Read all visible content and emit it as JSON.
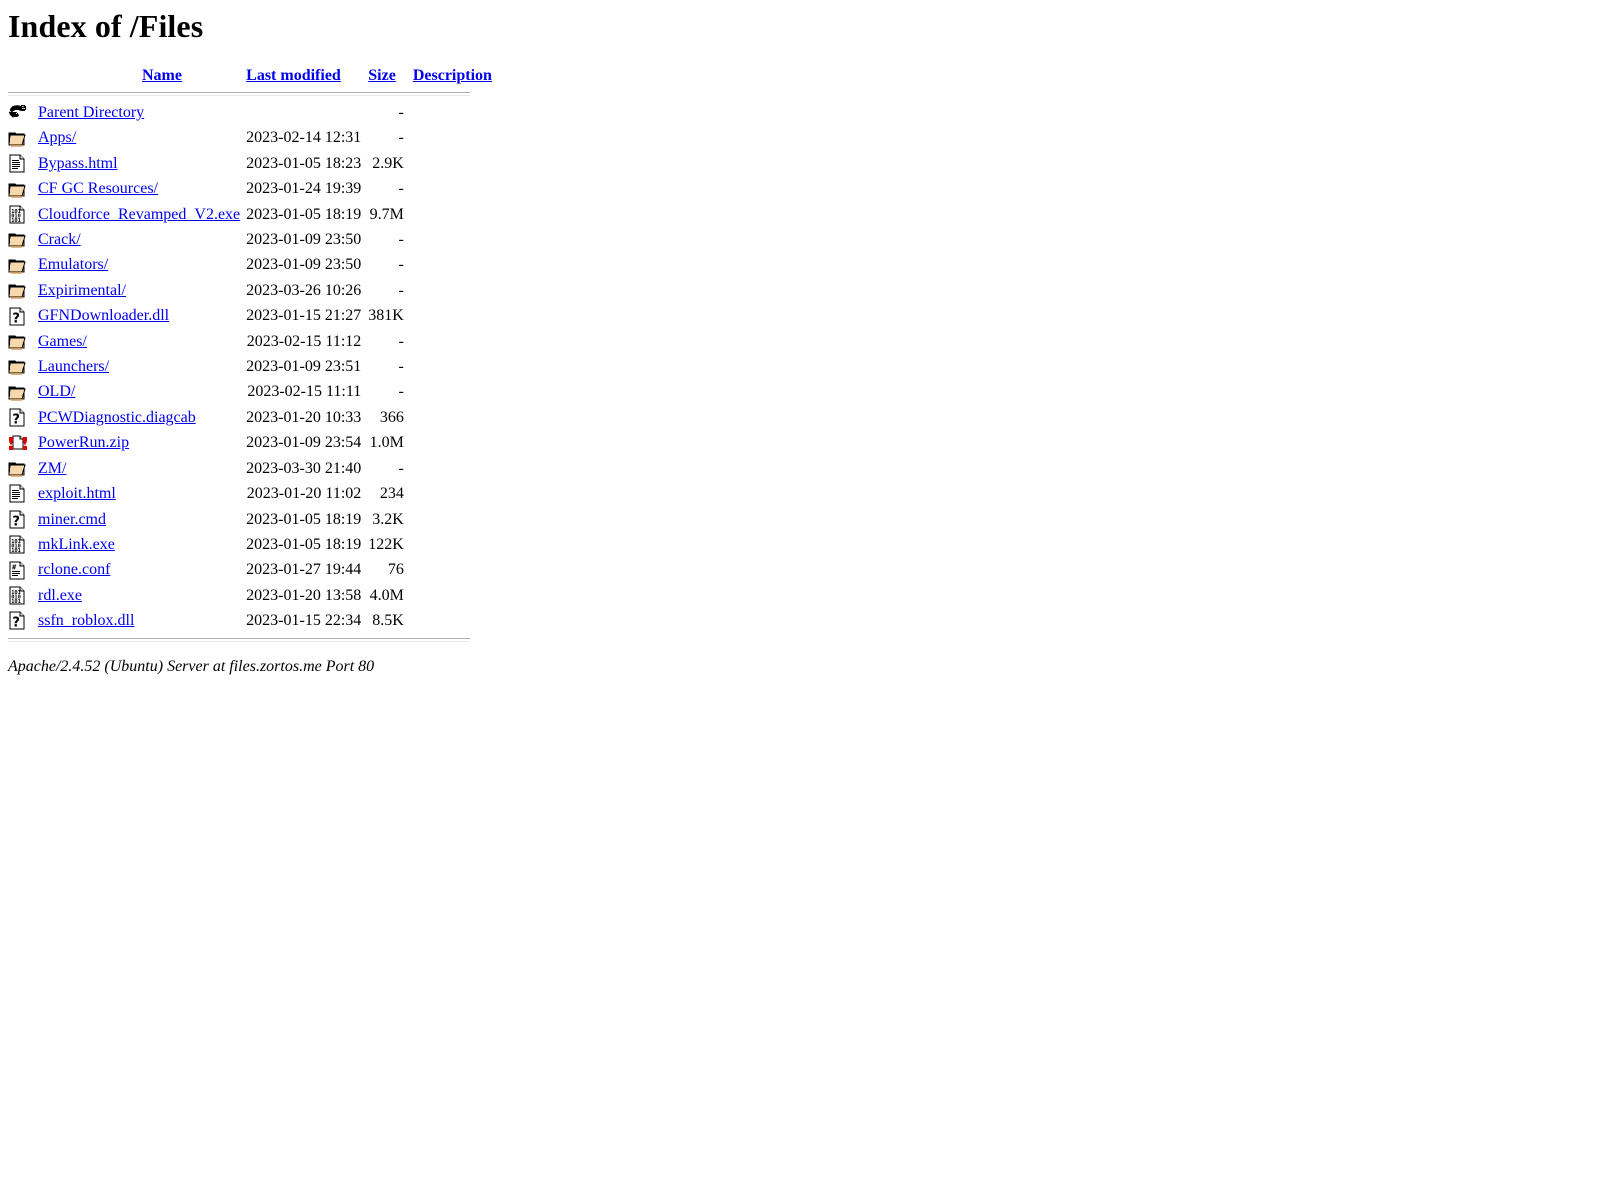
{
  "page": {
    "title": "Index of /Files",
    "document_title": "Index of /Files"
  },
  "table": {
    "headers": {
      "name": "Name",
      "last_modified": "Last modified",
      "size": "Size",
      "description": "Description"
    },
    "rows": [
      {
        "icon": "back-icon",
        "name": "Parent Directory",
        "last_modified": "",
        "size": "-",
        "description": ""
      },
      {
        "icon": "folder-icon",
        "name": "Apps/",
        "last_modified": "2023-02-14 12:31",
        "size": "-",
        "description": ""
      },
      {
        "icon": "html-icon",
        "name": "Bypass.html",
        "last_modified": "2023-01-05 18:23",
        "size": "2.9K",
        "description": ""
      },
      {
        "icon": "folder-icon",
        "name": "CF GC Resources/",
        "last_modified": "2023-01-24 19:39",
        "size": "-",
        "description": ""
      },
      {
        "icon": "binary-icon",
        "name": "Cloudforce_Revamped_V2.exe",
        "last_modified": "2023-01-05 18:19",
        "size": "9.7M",
        "description": ""
      },
      {
        "icon": "folder-icon",
        "name": "Crack/",
        "last_modified": "2023-01-09 23:50",
        "size": "-",
        "description": ""
      },
      {
        "icon": "folder-icon",
        "name": "Emulators/",
        "last_modified": "2023-01-09 23:50",
        "size": "-",
        "description": ""
      },
      {
        "icon": "folder-icon",
        "name": "Expirimental/",
        "last_modified": "2023-03-26 10:26",
        "size": "-",
        "description": ""
      },
      {
        "icon": "unknown-icon",
        "name": "GFNDownloader.dll",
        "last_modified": "2023-01-15 21:27",
        "size": "381K",
        "description": ""
      },
      {
        "icon": "folder-icon",
        "name": "Games/",
        "last_modified": "2023-02-15 11:12",
        "size": "-",
        "description": ""
      },
      {
        "icon": "folder-icon",
        "name": "Launchers/",
        "last_modified": "2023-01-09 23:51",
        "size": "-",
        "description": ""
      },
      {
        "icon": "folder-icon",
        "name": "OLD/",
        "last_modified": "2023-02-15 11:11",
        "size": "-",
        "description": ""
      },
      {
        "icon": "unknown-icon",
        "name": "PCWDiagnostic.diagcab",
        "last_modified": "2023-01-20 10:33",
        "size": "366",
        "description": ""
      },
      {
        "icon": "compressed-icon",
        "name": "PowerRun.zip",
        "last_modified": "2023-01-09 23:54",
        "size": "1.0M",
        "description": ""
      },
      {
        "icon": "folder-icon",
        "name": "ZM/",
        "last_modified": "2023-03-30 21:40",
        "size": "-",
        "description": ""
      },
      {
        "icon": "html-icon",
        "name": "exploit.html",
        "last_modified": "2023-01-20 11:02",
        "size": "234",
        "description": ""
      },
      {
        "icon": "unknown-icon",
        "name": "miner.cmd",
        "last_modified": "2023-01-05 18:19",
        "size": "3.2K",
        "description": ""
      },
      {
        "icon": "binary-icon",
        "name": "mkLink.exe",
        "last_modified": "2023-01-05 18:19",
        "size": "122K",
        "description": ""
      },
      {
        "icon": "text-icon",
        "name": "rclone.conf",
        "last_modified": "2023-01-27 19:44",
        "size": "76",
        "description": ""
      },
      {
        "icon": "binary-icon",
        "name": "rdl.exe",
        "last_modified": "2023-01-20 13:58",
        "size": "4.0M",
        "description": ""
      },
      {
        "icon": "unknown-icon",
        "name": "ssfn_roblox.dll",
        "last_modified": "2023-01-15 22:34",
        "size": "8.5K",
        "description": ""
      }
    ]
  },
  "footer": {
    "text": "Apache/2.4.52 (Ubuntu) Server at files.zortos.me Port 80"
  },
  "colors": {
    "link": "#0000EE",
    "folder": "#F2C896",
    "folder_shade": "#E0B078",
    "compressed": "#E00000",
    "text": "#000000",
    "rule": "#AEAEAE",
    "background": "#FFFFFF"
  }
}
